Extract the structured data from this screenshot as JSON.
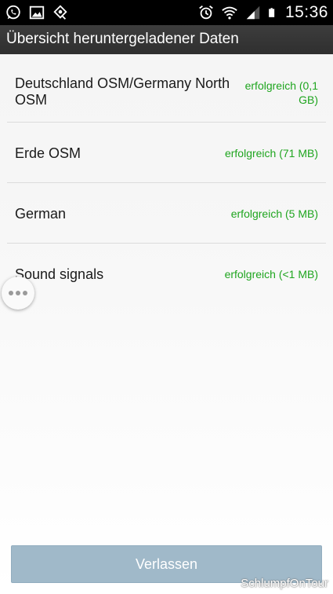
{
  "status_bar": {
    "left_icons": [
      "whatsapp-icon",
      "gallery-icon",
      "location-app-icon"
    ],
    "right_icons": [
      "alarm-icon",
      "wifi-icon",
      "signal-icon",
      "battery-icon"
    ],
    "time": "15:36"
  },
  "title": "Übersicht heruntergeladener Daten",
  "items": [
    {
      "name": "Deutschland OSM/Germany North OSM",
      "status": "erfolgreich (0,1 GB)"
    },
    {
      "name": "Erde OSM",
      "status": "erfolgreich (71 MB)"
    },
    {
      "name": "German",
      "status": "erfolgreich (5 MB)"
    },
    {
      "name": "Sound signals",
      "status": "erfolgreich (<1 MB)"
    }
  ],
  "exit_button_label": "Verlassen",
  "watermark": "SchlumpfOnTour",
  "colors": {
    "status_green": "#1fa51f",
    "button_bg": "#a0b9c9",
    "titlebar_bg": "#333333"
  }
}
